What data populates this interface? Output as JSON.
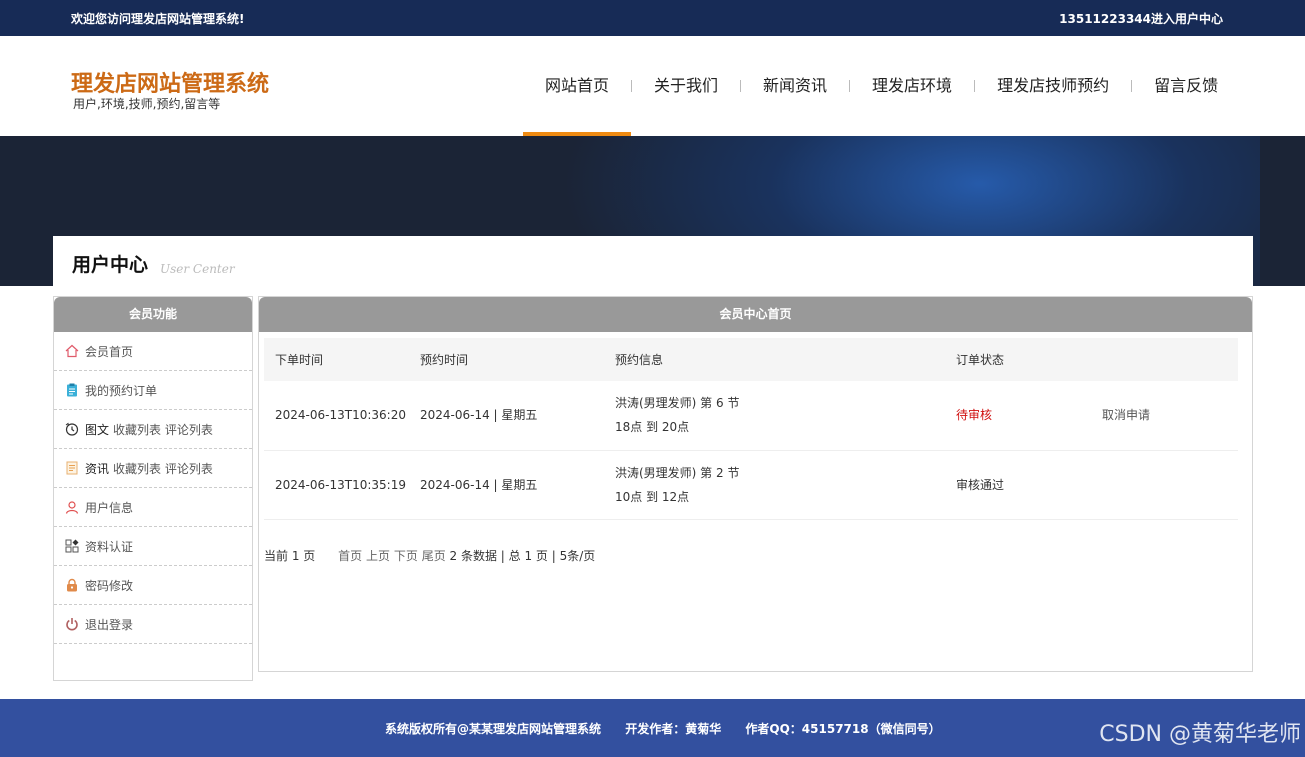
{
  "topbar": {
    "welcome": "欢迎您访问理发店网站管理系统!",
    "user_center": "13511223344进入用户中心"
  },
  "brand": {
    "title": "理发店网站管理系统",
    "subtitle": "用户,环境,技师,预约,留言等"
  },
  "nav": [
    {
      "label": "网站首页"
    },
    {
      "label": "关于我们"
    },
    {
      "label": "新闻资讯"
    },
    {
      "label": "理发店环境"
    },
    {
      "label": "理发店技师预约"
    },
    {
      "label": "留言反馈"
    }
  ],
  "page": {
    "title": "用户中心",
    "title_en": "User Center"
  },
  "sidebar": {
    "header": "会员功能",
    "items": [
      {
        "label": "会员首页",
        "icon": "home-icon"
      },
      {
        "label": "我的预约订单",
        "icon": "clipboard-icon"
      },
      {
        "label": "图文",
        "extra": "收藏列表 评论列表",
        "icon": "history-icon"
      },
      {
        "label": "资讯",
        "extra": "收藏列表 评论列表",
        "icon": "document-icon"
      },
      {
        "label": "用户信息",
        "icon": "user-icon"
      },
      {
        "label": "资料认证",
        "icon": "grid-icon"
      },
      {
        "label": "密码修改",
        "icon": "lock-icon"
      },
      {
        "label": "退出登录",
        "icon": "power-icon"
      }
    ]
  },
  "main": {
    "header": "会员中心首页",
    "columns": [
      "下单时间",
      "预约时间",
      "预约信息",
      "订单状态",
      ""
    ],
    "rows": [
      {
        "order_time": "2024-06-13T10:36:20",
        "appt_time": "2024-06-14 | 星期五",
        "info_line1": "洪涛(男理发师) 第 6 节",
        "info_line2": "18点 到 20点",
        "status": "待审核",
        "action": "取消申请"
      },
      {
        "order_time": "2024-06-13T10:35:19",
        "appt_time": "2024-06-14 | 星期五",
        "info_line1": "洪涛(男理发师) 第 2 节",
        "info_line2": "10点 到 12点",
        "status": "审核通过",
        "action": ""
      }
    ],
    "pager": {
      "current": "当前 1 页",
      "first": "首页",
      "prev": "上页",
      "next": "下页",
      "last": "尾页",
      "summary": "2 条数据 | 总 1 页 | 5条/页"
    }
  },
  "footer": {
    "copyright": "系统版权所有@某某理发店网站管理系统",
    "author": "开发作者：黄菊华",
    "qq": "作者QQ：45157718（微信同号）",
    "watermark": "CSDN @黄菊华老师"
  },
  "colors": {
    "topbar": "#172b56",
    "brand": "#cc6a16",
    "nav_active": "#ee8a12",
    "footer": "#33509f",
    "status_pending": "#d01010"
  }
}
